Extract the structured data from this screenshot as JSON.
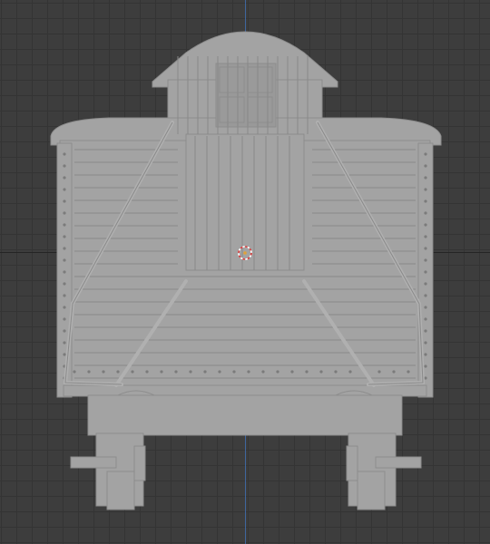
{
  "viewport": {
    "mode": "orthographic-front",
    "background_color": "#3d3d3d",
    "grid_color": "#343434",
    "x_axis_color": "#252525",
    "y_axis_color": "#3f6aa8",
    "model_color": "#a3a3a3",
    "model_edge_color": "#8a8a8a"
  },
  "scene_object": {
    "kind": "boxcar-with-cupola",
    "cupola_window_panes": 4
  },
  "icons": {
    "cursor": "3d-cursor-icon"
  }
}
